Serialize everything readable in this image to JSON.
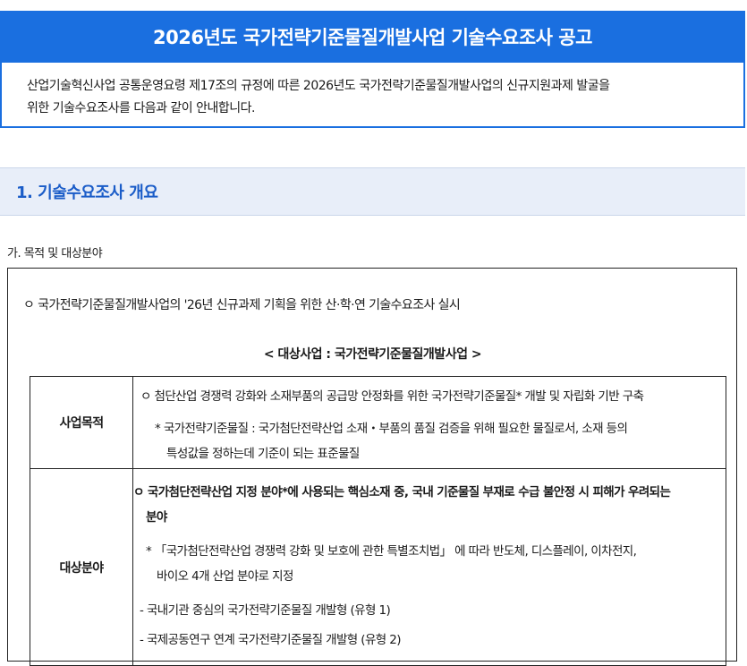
{
  "header": {
    "title": "2026년도 국가전략기준물질개발사업 기술수요조사 공고"
  },
  "intro": {
    "line1": "산업기술혁신사업 공통운영요령 제17조의 규정에 따른 2026년도 국가전략기준물질개발사업의 신규지원과제 발굴을",
    "line2": "위한 기술수요조사를 다음과 같이 안내합니다."
  },
  "section1": {
    "title": "1. 기술수요조사 개요",
    "subheading": "가. 목적 및 대상분야",
    "summary": "ㅇ 국가전략기준물질개발사업의 '26년 신규과제 기획을 위한 산·학·연 기술수요조사 실시",
    "program_title": "< 대상사업 : 국가전략기준물질개발사업 >",
    "purpose": {
      "label": "사업목적",
      "line1": "ㅇ 첨단산업 경쟁력 강화와 소재부품의 공급망 안정화를 위한 국가전략기준물질* 개발 및 자립화 기반 구축",
      "note1": "* 국가전략기준물질 : 국가첨단전략산업 소재・부품의 품질 검증을 위해 필요한 물질로서, 소재 등의",
      "note2": "특성값을 정하는데 기준이 되는 표준물질"
    },
    "target": {
      "label": "대상분야",
      "line1": "ㅇ 국가첨단전략산업 지정 분야*에 사용되는 핵심소재 중, 국내 기준물질 부재로 수급 불안정 시 피해가 우려되는",
      "line2": "분야",
      "note1": "* 「국가첨단전략산업 경쟁력 강화 및 보호에 관한 특별조치법」 에 따라 반도체, 디스플레이, 이차전지,",
      "note2": "바이오 4개 산업 분야로 지정",
      "type1": "- 국내기관 중심의 국가전략기준물질 개발형 (유형 1)",
      "type2": "- 국제공동연구 연계 국가전략기준물질 개발형 (유형 2)"
    }
  }
}
